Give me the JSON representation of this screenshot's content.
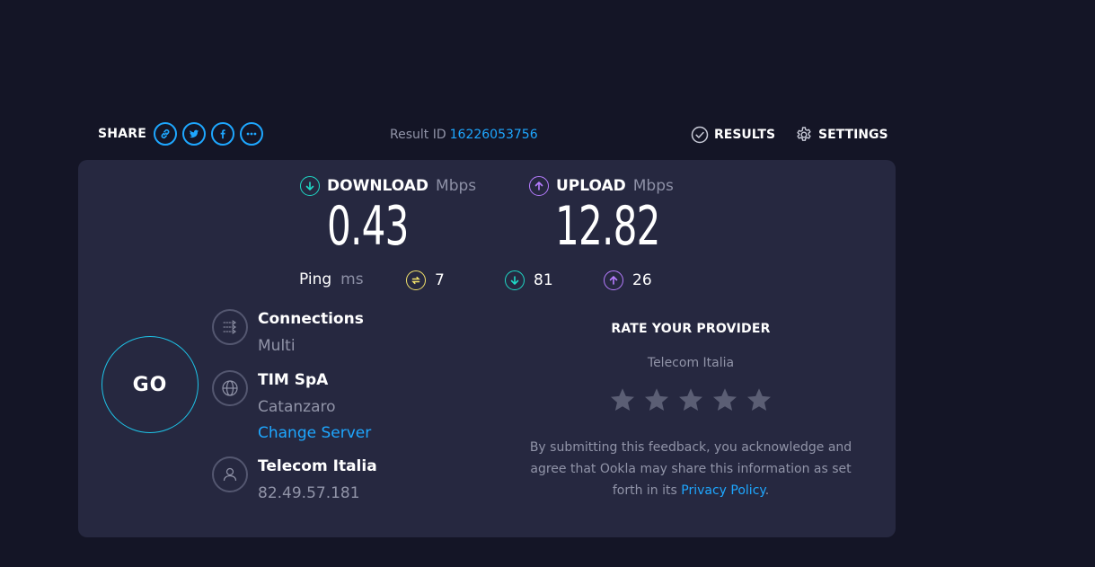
{
  "header": {
    "share_label": "SHARE",
    "result_id_label": "Result ID",
    "result_id_value": "16226053756",
    "results_label": "RESULTS",
    "settings_label": "SETTINGS"
  },
  "download": {
    "label": "DOWNLOAD",
    "unit": "Mbps",
    "value": "0.43"
  },
  "upload": {
    "label": "UPLOAD",
    "unit": "Mbps",
    "value": "12.82"
  },
  "ping": {
    "label": "Ping",
    "unit": "ms",
    "idle": "7",
    "download": "81",
    "upload": "26"
  },
  "go_label": "GO",
  "connections": {
    "title": "Connections",
    "value": "Multi"
  },
  "server": {
    "name": "TIM SpA",
    "location": "Catanzaro",
    "change_label": "Change Server"
  },
  "provider": {
    "name": "Telecom Italia",
    "ip": "82.49.57.181"
  },
  "rate": {
    "title": "RATE YOUR PROVIDER",
    "provider": "Telecom Italia",
    "disclaimer_line1": "By submitting this feedback, you acknowledge and",
    "disclaimer_line2": "agree that Ookla may share this information as set",
    "disclaimer_line3_prefix": "forth in its ",
    "privacy_link": "Privacy Policy",
    "disclaimer_suffix": "."
  },
  "colors": {
    "background": "#141526",
    "panel": "#262840",
    "accent_blue": "#1ea7ff",
    "download_teal": "#1ed9c6",
    "upload_purple": "#b67cff",
    "ping_yellow": "#f3e36b",
    "star_gray": "#5b5e74"
  }
}
